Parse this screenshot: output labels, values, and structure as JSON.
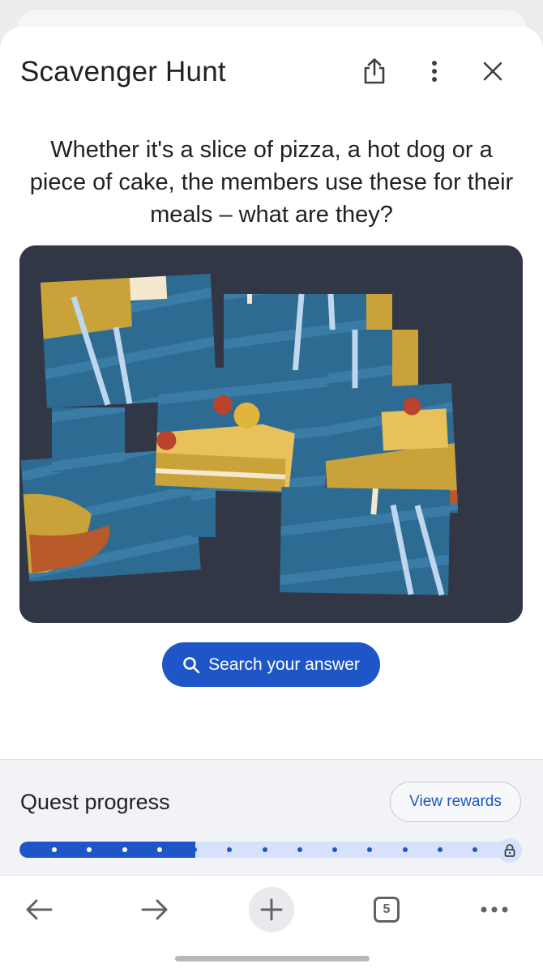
{
  "header": {
    "title": "Scavenger Hunt",
    "share_icon": "share-icon",
    "more_icon": "more-vert-icon",
    "close_icon": "close-icon"
  },
  "question": "Whether it's a slice of pizza, a hot dog or a piece of cake, the members use these for their meals – what are they?",
  "puzzle_image": {
    "semantic": "scrambled puzzle tiles of food on toothpicks"
  },
  "search_button": {
    "label": "Search your answer",
    "icon": "search-icon"
  },
  "quest_progress": {
    "title": "Quest progress",
    "rewards_label": "View rewards",
    "progress_fraction": 0.35,
    "total_steps": 13,
    "completed_steps": 4,
    "lock_icon": "lock-icon"
  },
  "bottom_nav": {
    "back_icon": "arrow-back-icon",
    "forward_icon": "arrow-forward-icon",
    "new_tab_icon": "plus-icon",
    "tab_count": "5",
    "menu_icon": "more-horiz-icon"
  },
  "colors": {
    "accent": "#1f56c7",
    "accent_light": "#d6e2fb",
    "puzzle_bg": "#313744",
    "tile_blue": "#2d6b93"
  }
}
